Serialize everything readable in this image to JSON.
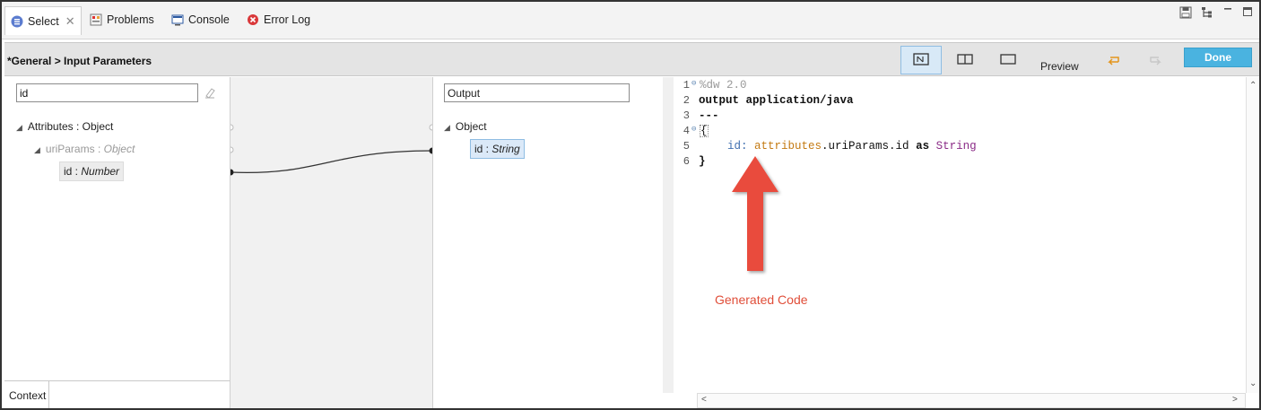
{
  "tabs": [
    {
      "label": "Select",
      "icon": "select-icon",
      "closable": true
    },
    {
      "label": "Problems",
      "icon": "problems-icon"
    },
    {
      "label": "Console",
      "icon": "console-icon"
    },
    {
      "label": "Error Log",
      "icon": "error-log-icon"
    }
  ],
  "header": {
    "title": "*General > Input Parameters",
    "preview_label": "Preview",
    "done_label": "Done"
  },
  "input": {
    "search_value": "id",
    "tree": [
      {
        "name": "Attributes",
        "type": "Object"
      },
      {
        "name": "uriParams",
        "type": "Object"
      },
      {
        "name": "id",
        "type": "Number"
      }
    ],
    "context_tab": "Context"
  },
  "output": {
    "box_value": "Output",
    "tree": [
      {
        "name": "Object"
      },
      {
        "name": "id",
        "type": "String"
      }
    ]
  },
  "editor": {
    "lines": [
      {
        "n": "1",
        "text": "%dw 2.0"
      },
      {
        "n": "2",
        "text": "output application/java"
      },
      {
        "n": "3",
        "text": "---"
      },
      {
        "n": "4",
        "text": "{"
      },
      {
        "n": "5",
        "id": "id:",
        "attr": "attributes",
        "rest": ".uriParams.id",
        "as": "as",
        "type": "String"
      },
      {
        "n": "6",
        "text": "}"
      }
    ]
  },
  "annotation": {
    "label": "Generated Code",
    "color": "#e04e39"
  },
  "colors": {
    "done_button": "#4ab3e0",
    "selection": "#dbe9f8"
  }
}
